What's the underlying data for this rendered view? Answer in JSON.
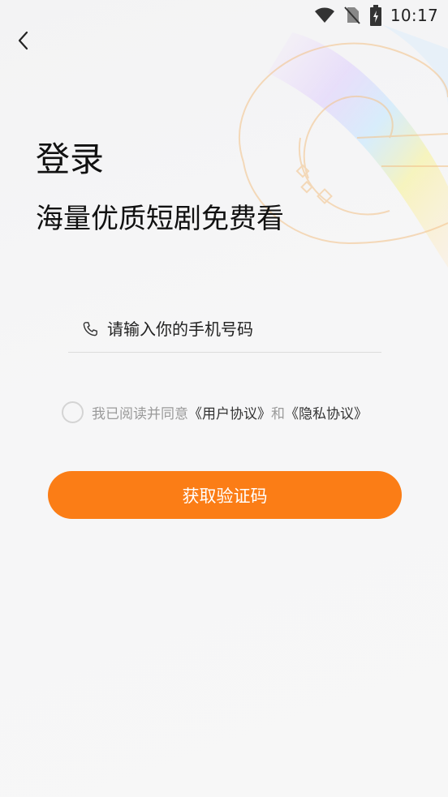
{
  "status_bar": {
    "time": "10:17",
    "icons": [
      "wifi-icon",
      "no-sim-icon",
      "battery-charging-icon"
    ]
  },
  "header": {
    "back_icon": "chevron-left-icon"
  },
  "login": {
    "title": "登录",
    "subtitle": "海量优质短剧免费看"
  },
  "phone": {
    "icon": "phone-icon",
    "placeholder": "请输入你的手机号码",
    "value": ""
  },
  "agreement": {
    "checked": false,
    "prefix": "我已阅读并同意",
    "user_agreement": "《用户协议》",
    "connector": "和",
    "privacy_agreement": "《隐私协议》"
  },
  "submit": {
    "label": "获取验证码"
  },
  "colors": {
    "accent": "#fb7d16",
    "text": "#111111",
    "muted": "#9a9a9a",
    "divider": "#dcdcdc"
  }
}
